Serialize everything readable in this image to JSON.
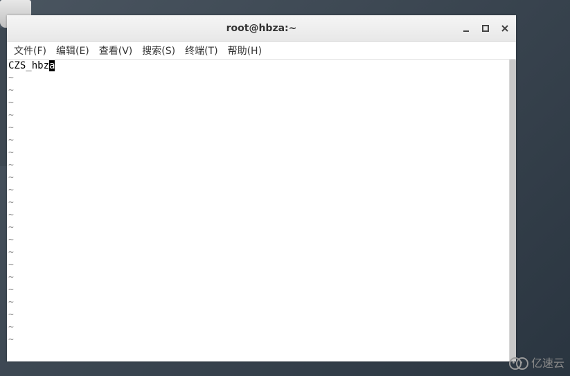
{
  "window": {
    "title": "root@hbza:~"
  },
  "menu": {
    "file": "文件(F)",
    "edit": "编辑(E)",
    "view": "查看(V)",
    "search": "搜索(S)",
    "terminal": "终端(T)",
    "help": "帮助(H)"
  },
  "editor": {
    "content_prefix": "CZS_hbz",
    "cursor_char": "a",
    "tilde_count": 22
  },
  "watermark": {
    "text": "亿速云"
  }
}
